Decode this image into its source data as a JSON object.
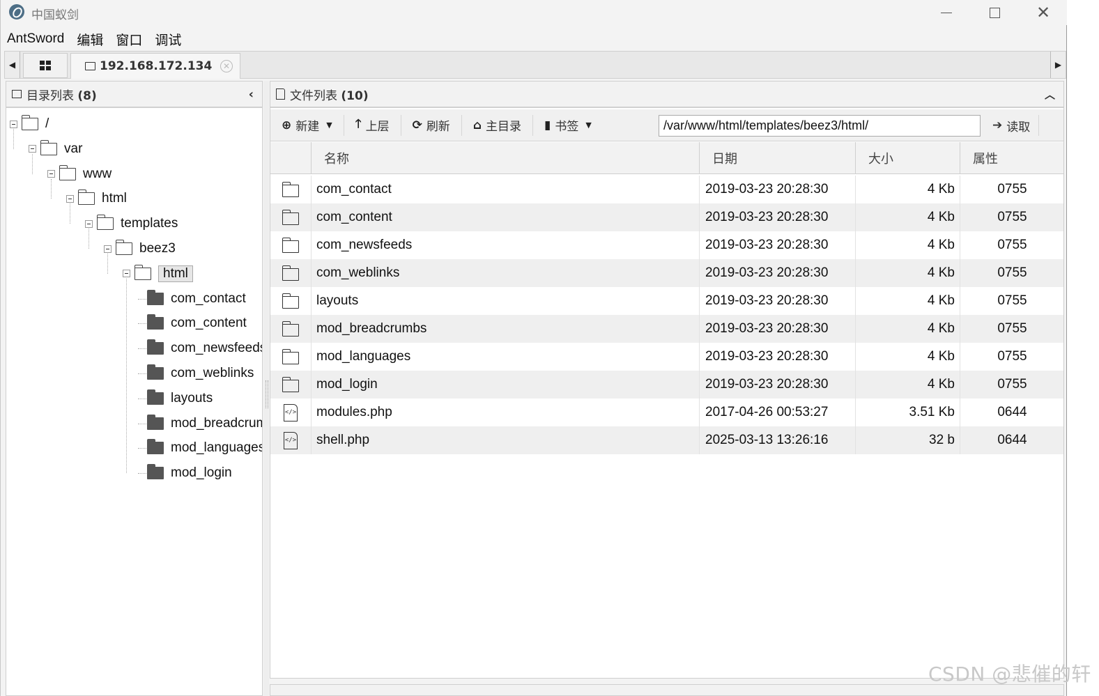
{
  "window": {
    "title": "中国蚁剑"
  },
  "menu": {
    "items": [
      "AntSword",
      "编辑",
      "窗口",
      "调试"
    ]
  },
  "tabs": {
    "active_label": "192.168.172.134"
  },
  "dir_panel": {
    "title": "目录列表",
    "count": "(8)"
  },
  "tree": {
    "nodes": [
      {
        "label": "/",
        "depth": 0,
        "expanded": true
      },
      {
        "label": "var",
        "depth": 1,
        "expanded": true
      },
      {
        "label": "www",
        "depth": 2,
        "expanded": true
      },
      {
        "label": "html",
        "depth": 3,
        "expanded": true
      },
      {
        "label": "templates",
        "depth": 4,
        "expanded": true
      },
      {
        "label": "beez3",
        "depth": 5,
        "expanded": true
      },
      {
        "label": "html",
        "depth": 6,
        "expanded": true,
        "selected": true
      },
      {
        "label": "com_contact",
        "depth": 7
      },
      {
        "label": "com_content",
        "depth": 7
      },
      {
        "label": "com_newsfeeds",
        "depth": 7
      },
      {
        "label": "com_weblinks",
        "depth": 7
      },
      {
        "label": "layouts",
        "depth": 7
      },
      {
        "label": "mod_breadcrumbs",
        "depth": 7
      },
      {
        "label": "mod_languages",
        "depth": 7
      },
      {
        "label": "mod_login",
        "depth": 7
      }
    ]
  },
  "file_panel": {
    "title": "文件列表",
    "count": "(10)"
  },
  "toolbar": {
    "new_label": "新建",
    "up_label": "上层",
    "refresh_label": "刷新",
    "home_label": "主目录",
    "bookmark_label": "书签",
    "path_value": "/var/www/html/templates/beez3/html/",
    "read_label": "读取"
  },
  "columns": {
    "name": "名称",
    "date": "日期",
    "size": "大小",
    "attr": "属性"
  },
  "files": [
    {
      "type": "folder",
      "name": "com_contact",
      "date": "2019-03-23 20:28:30",
      "size": "4 Kb",
      "attr": "0755"
    },
    {
      "type": "folder",
      "name": "com_content",
      "date": "2019-03-23 20:28:30",
      "size": "4 Kb",
      "attr": "0755"
    },
    {
      "type": "folder",
      "name": "com_newsfeeds",
      "date": "2019-03-23 20:28:30",
      "size": "4 Kb",
      "attr": "0755"
    },
    {
      "type": "folder",
      "name": "com_weblinks",
      "date": "2019-03-23 20:28:30",
      "size": "4 Kb",
      "attr": "0755"
    },
    {
      "type": "folder",
      "name": "layouts",
      "date": "2019-03-23 20:28:30",
      "size": "4 Kb",
      "attr": "0755"
    },
    {
      "type": "folder",
      "name": "mod_breadcrumbs",
      "date": "2019-03-23 20:28:30",
      "size": "4 Kb",
      "attr": "0755"
    },
    {
      "type": "folder",
      "name": "mod_languages",
      "date": "2019-03-23 20:28:30",
      "size": "4 Kb",
      "attr": "0755"
    },
    {
      "type": "folder",
      "name": "mod_login",
      "date": "2019-03-23 20:28:30",
      "size": "4 Kb",
      "attr": "0755"
    },
    {
      "type": "file",
      "name": "modules.php",
      "date": "2017-04-26 00:53:27",
      "size": "3.51 Kb",
      "attr": "0644"
    },
    {
      "type": "file",
      "name": "shell.php",
      "date": "2025-03-13 13:26:16",
      "size": "32 b",
      "attr": "0644"
    }
  ],
  "watermark": "CSDN @悲催的轩"
}
